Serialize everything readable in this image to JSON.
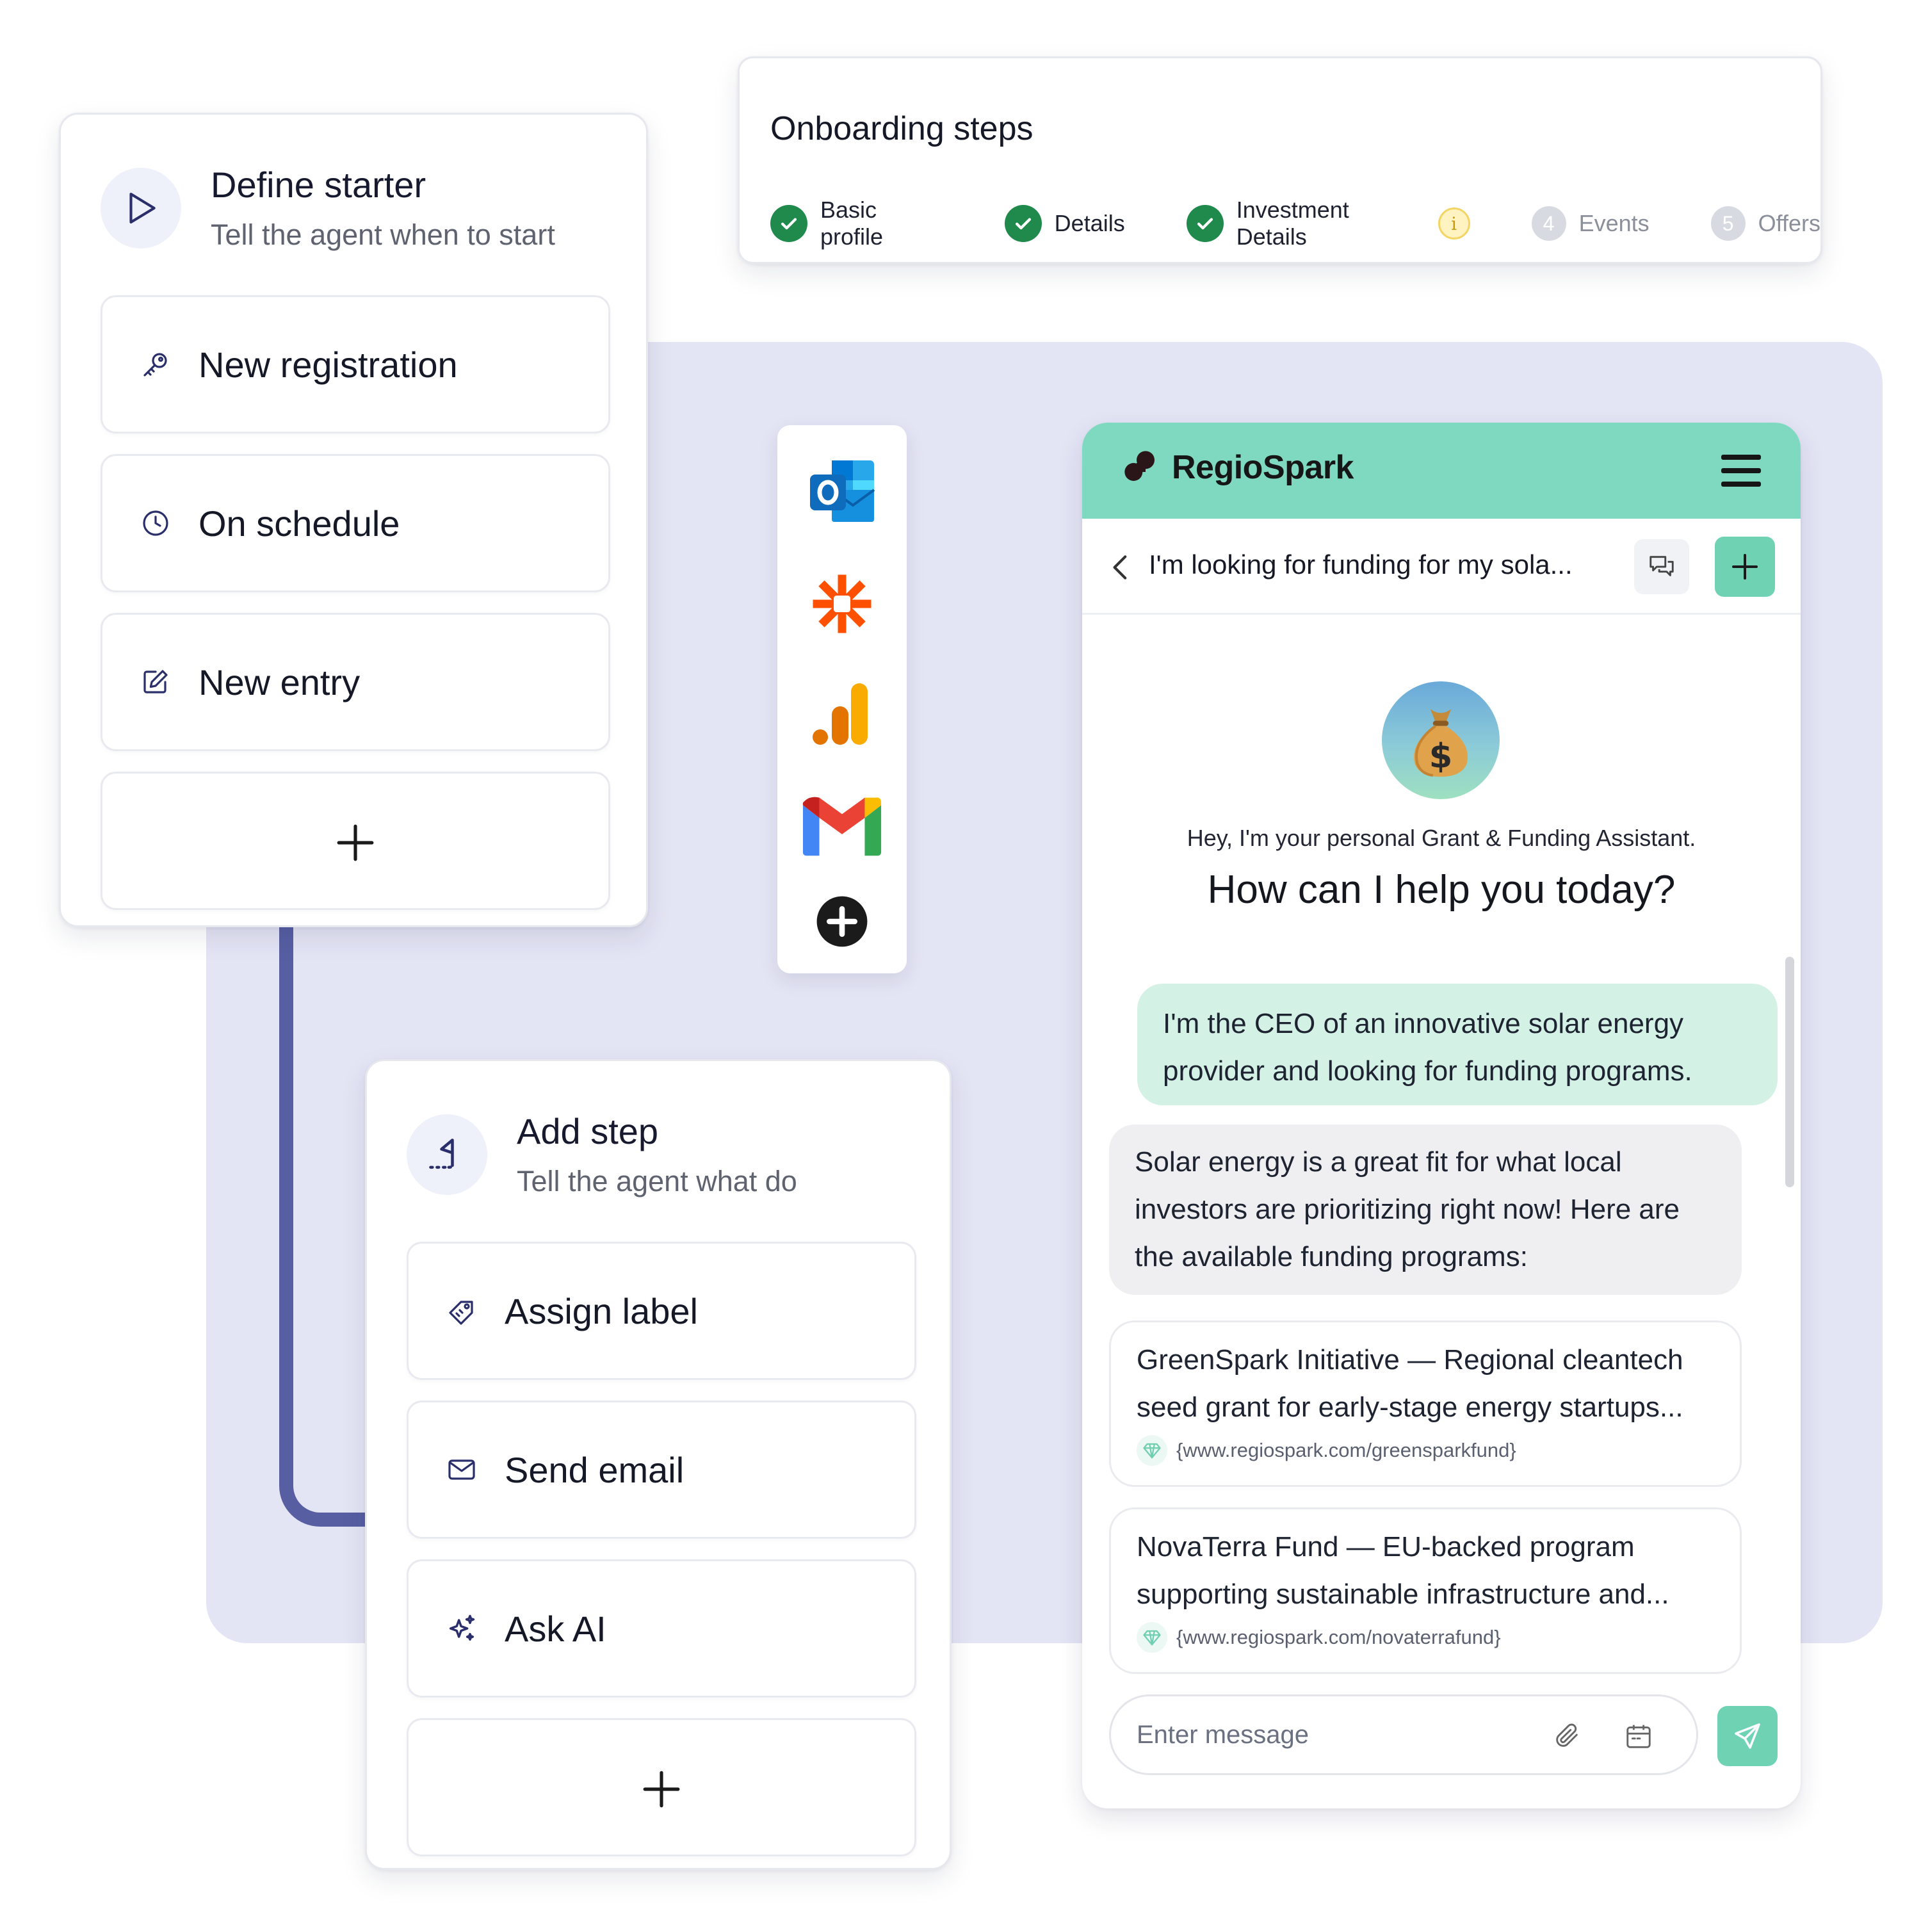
{
  "starter": {
    "title": "Define starter",
    "subtitle": "Tell the agent when to start",
    "options": [
      {
        "label": "New registration",
        "icon": "key-icon"
      },
      {
        "label": "On schedule",
        "icon": "clock-icon"
      },
      {
        "label": "New entry",
        "icon": "edit-icon"
      }
    ],
    "add_icon": "plus-icon"
  },
  "onboarding": {
    "title": "Onboarding steps",
    "steps": [
      {
        "label": "Basic profile",
        "status": "done"
      },
      {
        "label": "Details",
        "status": "done"
      },
      {
        "label": "Investment Details",
        "status": "done",
        "warning": true
      },
      {
        "number": "4",
        "label": "Events",
        "status": "pending"
      },
      {
        "number": "5",
        "label": "Offers",
        "status": "pending"
      }
    ]
  },
  "integrations": [
    "outlook-icon",
    "zapier-icon",
    "analytics-icon",
    "gmail-icon",
    "add-integration-icon"
  ],
  "add_step": {
    "title": "Add step",
    "subtitle": "Tell the agent what do",
    "options": [
      {
        "label": "Assign label",
        "icon": "tag-icon"
      },
      {
        "label": "Send email",
        "icon": "mail-icon"
      },
      {
        "label": "Ask AI",
        "icon": "sparkle-icon"
      }
    ],
    "add_icon": "plus-icon"
  },
  "chat": {
    "brand": "RegioSpark",
    "conversation_title": "I'm looking for funding for my sola...",
    "greeting_small": "Hey, I'm your personal Grant & Funding Assistant.",
    "greeting_big": "How can I help you today?",
    "user_message": "I'm the CEO of an innovative solar energy provider and looking for funding programs.",
    "bot_message": "Solar energy is a great fit for what local investors are prioritizing right now! Here are the available funding programs:",
    "programs": [
      {
        "text": "GreenSpark Initiative — Regional cleantech seed grant for early-stage energy startups...",
        "url": "{www.regiospark.com/greensparkfund}"
      },
      {
        "text": "NovaTerra Fund — EU-backed program supporting sustainable infrastructure and...",
        "url": "{www.regiospark.com/novaterrafund}"
      }
    ],
    "input_placeholder": "Enter message"
  },
  "colors": {
    "canvas": "#e3e4f4",
    "connector": "#575ea2",
    "chat_header": "#7fd9c0",
    "accent": "#6fd3b3",
    "user_bubble": "#d4f1e6",
    "bot_bubble": "#efeff1",
    "step_done": "#1f8a4c"
  }
}
